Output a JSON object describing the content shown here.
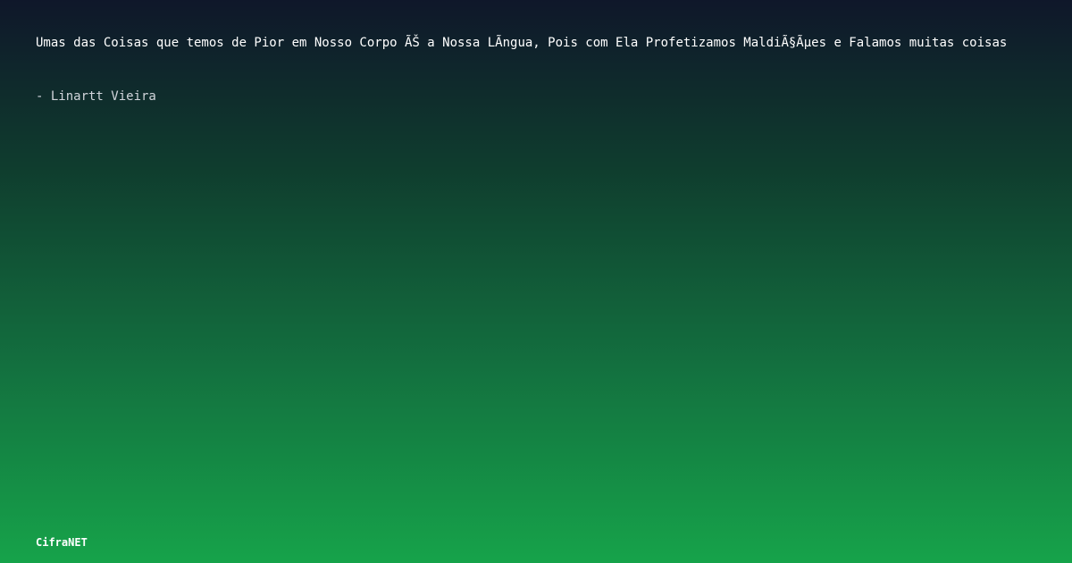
{
  "quote": {
    "text": "Umas das Coisas que temos de Pior em Nosso Corpo ÃŠ a Nossa LÃ­ngua, Pois com Ela Profetizamos MaldiÃ§Ãµes e Falamos muitas coisas",
    "author": "- Linartt Vieira"
  },
  "brand": {
    "name": "CifraNET"
  },
  "colors": {
    "gradient_top": "#0f172a",
    "gradient_bottom": "#16a34a",
    "text": "#ffffff"
  }
}
